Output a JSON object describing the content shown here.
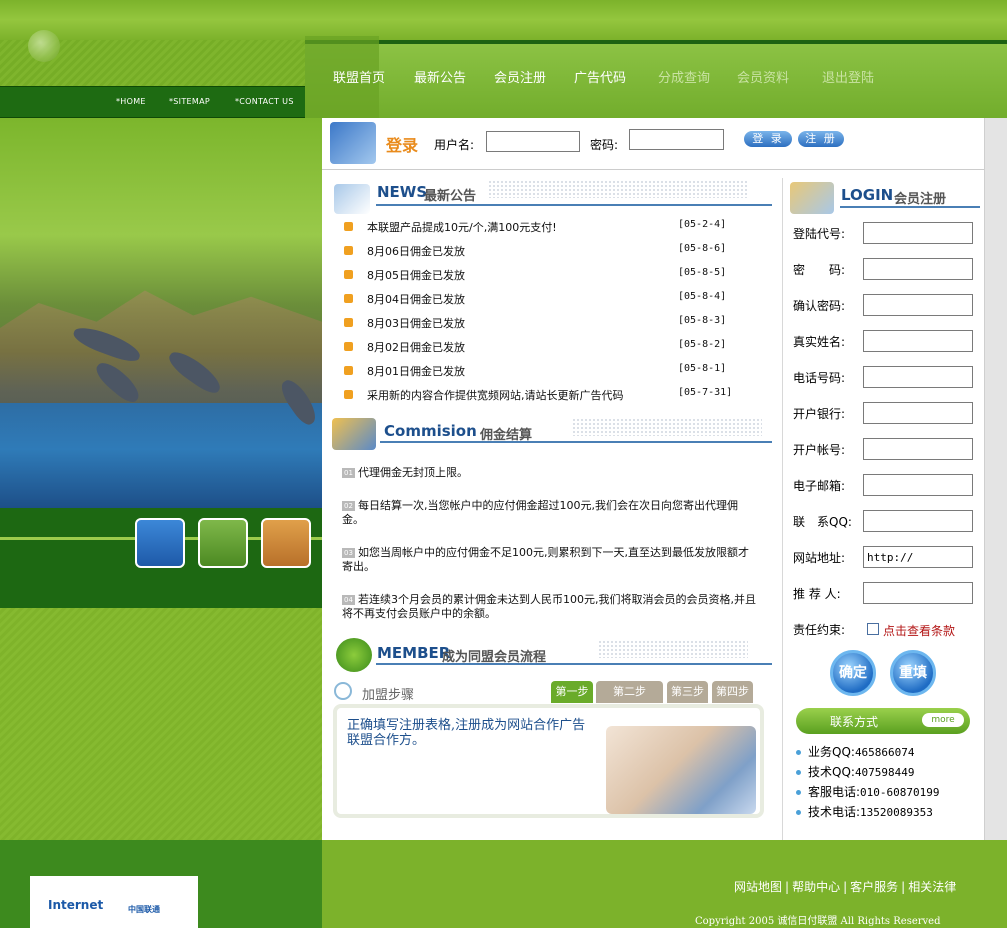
{
  "subnav": [
    "*HOME",
    "*SITEMAP",
    "*CONTACT US"
  ],
  "nav": {
    "items": [
      {
        "label": "联盟首页",
        "active": true
      },
      {
        "label": "最新公告",
        "active": false
      },
      {
        "label": "会员注册",
        "active": false
      },
      {
        "label": "广告代码",
        "active": false
      },
      {
        "label": "分成查询",
        "active": false
      },
      {
        "label": "会员资料",
        "active": false
      },
      {
        "label": "退出登陆",
        "active": false
      }
    ]
  },
  "login": {
    "title": "登录",
    "username_label": "用户名:",
    "username_value": "",
    "password_label": "密码:",
    "password_value": "",
    "login_button": "登 录",
    "register_button": "注 册"
  },
  "news": {
    "title": "NEWS",
    "subtitle": "最新公告",
    "items": [
      {
        "title": "本联盟产品提成10元/个,满100元支付!",
        "date": "[05-2-4]"
      },
      {
        "title": "8月06日佣金已发放",
        "date": "[05-8-6]"
      },
      {
        "title": "8月05日佣金已发放",
        "date": "[05-8-5]"
      },
      {
        "title": "8月04日佣金已发放",
        "date": "[05-8-4]"
      },
      {
        "title": "8月03日佣金已发放",
        "date": "[05-8-3]"
      },
      {
        "title": "8月02日佣金已发放",
        "date": "[05-8-2]"
      },
      {
        "title": "8月01日佣金已发放",
        "date": "[05-8-1]"
      },
      {
        "title": "采用新的内容合作提供宽频网站,请站长更新广告代码",
        "date": "[05-7-31]"
      }
    ]
  },
  "commission": {
    "title": "Commision",
    "subtitle": "佣金结算",
    "items": [
      {
        "num": "01",
        "text": "代理佣金无封顶上限。"
      },
      {
        "num": "02",
        "text": "每日结算一次,当您帐户中的应付佣金超过100元,我们会在次日向您寄出代理佣金。"
      },
      {
        "num": "03",
        "text": "如您当周帐户中的应付佣金不足100元,则累积到下一天,直至达到最低发放限额才寄出。"
      },
      {
        "num": "04",
        "text": "若连续3个月会员的累计佣金未达到人民币100元,我们将取消会员的会员资格,并且将不再支付会员账户中的余额。"
      }
    ]
  },
  "member": {
    "title": "MEMBER",
    "subtitle": "成为同盟会员流程",
    "steps_label": "加盟步骤",
    "steps": [
      "第一步",
      "第二步",
      "第三步",
      "第四步"
    ],
    "active_step": 0,
    "step_text": "正确填写注册表格,注册成为网站合作广告联盟合作方。"
  },
  "register": {
    "title": "LOGIN",
    "subtitle": "会员注册",
    "fields": [
      {
        "label": "登陆代号:",
        "value": ""
      },
      {
        "label": "密　　码:",
        "value": ""
      },
      {
        "label": "确认密码:",
        "value": ""
      },
      {
        "label": "真实姓名:",
        "value": ""
      },
      {
        "label": "电话号码:",
        "value": ""
      },
      {
        "label": "开户银行:",
        "value": ""
      },
      {
        "label": "开户帐号:",
        "value": ""
      },
      {
        "label": "电子邮箱:",
        "value": ""
      },
      {
        "label": "联　系QQ:",
        "value": ""
      },
      {
        "label": "网站地址:",
        "value": "http://"
      },
      {
        "label": "推 荐 人:",
        "value": ""
      }
    ],
    "terms_label": "责任约束:",
    "terms_link": "点击查看条款",
    "confirm_button": "确定",
    "reset_button": "重填"
  },
  "contact": {
    "title": "联系方式",
    "more": "more",
    "items": [
      {
        "label": "业务QQ:",
        "value": "465866074"
      },
      {
        "label": "技术QQ:",
        "value": "407598449"
      },
      {
        "label": "客服电话:",
        "value": "010-60870199"
      },
      {
        "label": "技术电话:",
        "value": "13520089353"
      }
    ]
  },
  "partners": {
    "logo1": "Internet",
    "logo2": "中国联通"
  },
  "footer": {
    "links": [
      "网站地图",
      "帮助中心",
      "客户服务",
      "相关法律"
    ],
    "copyright": "Copyright 2005 诚信日付联盟 All Rights Reserved"
  }
}
